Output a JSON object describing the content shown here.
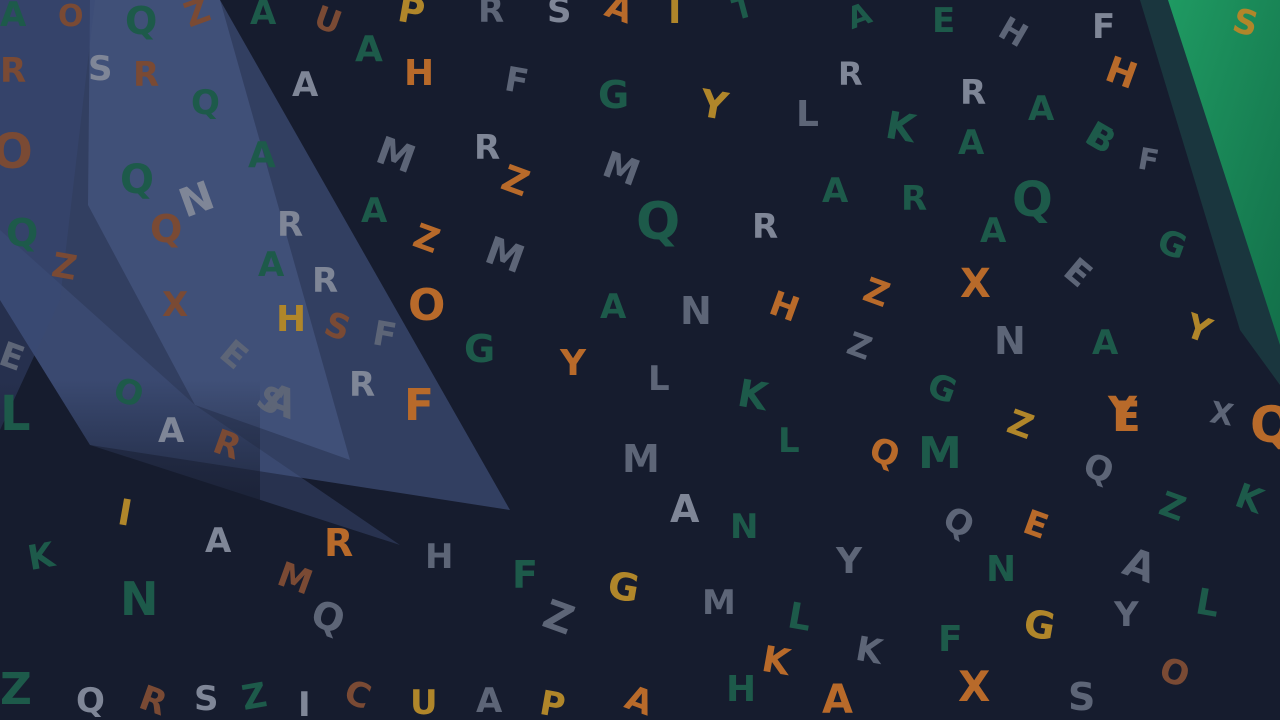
{
  "background": {
    "base_color": "#161c2e",
    "panel_color": "#3a4a75",
    "accent_stripe_color": "#1a8a5a"
  },
  "palette": {
    "gray": "#5d6577",
    "light_gray": "#7f8697",
    "orange": "#b86a2a",
    "amber": "#b0862a",
    "green": "#1d5a4a",
    "brown": "#7a4a34"
  },
  "letters": [
    "A",
    "O",
    "Q",
    "Z",
    "A",
    "U",
    "A",
    "P",
    "R",
    "S",
    "A",
    "I",
    "T",
    "A",
    "E",
    "H",
    "F",
    "S",
    "R",
    "S",
    "R",
    "A",
    "H",
    "F",
    "G",
    "Y",
    "R",
    "R",
    "A",
    "H",
    "Q",
    "E",
    "M",
    "R",
    "L",
    "K",
    "A",
    "B",
    "F",
    "O",
    "Q",
    "A",
    "N",
    "Z",
    "M",
    "Q",
    "R",
    "A",
    "R",
    "Q",
    "A",
    "G",
    "Q",
    "Q",
    "R",
    "Z",
    "A",
    "A",
    "R",
    "M",
    "E",
    "Z",
    "Z",
    "X",
    "H",
    "S",
    "F",
    "O",
    "G",
    "A",
    "N",
    "H",
    "Z",
    "X",
    "N",
    "Y",
    "E",
    "E",
    "R",
    "Y",
    "L",
    "F",
    "G",
    "A",
    "K",
    "Y",
    "X",
    "L",
    "Q",
    "O",
    "A",
    "Q",
    "M",
    "Z",
    "Q",
    "E",
    "L",
    "A",
    "R",
    "S",
    "M",
    "A",
    "N",
    "Q",
    "E",
    "Z",
    "K",
    "K",
    "I",
    "A",
    "R",
    "H",
    "F",
    "G",
    "Y",
    "N",
    "A",
    "N",
    "Q",
    "M",
    "Z",
    "M",
    "L",
    "K",
    "F",
    "G",
    "Y",
    "L",
    "K",
    "H",
    "A",
    "X",
    "O",
    "Z",
    "Q",
    "R",
    "S",
    "Z",
    "I",
    "C",
    "U",
    "A",
    "P",
    "A",
    "S",
    "N"
  ]
}
